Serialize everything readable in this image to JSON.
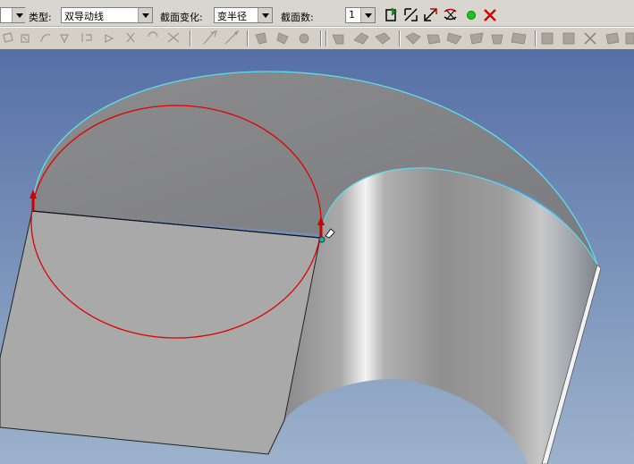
{
  "toolbar": {
    "type_label": "类型:",
    "type_value": "双导动线",
    "section_change_label": "截面变化:",
    "section_change_value": "变半径",
    "section_count_label": "截面数:",
    "section_count_value": "1"
  },
  "colors": {
    "guide_curve": "#e00000",
    "edge_highlight": "#58e0f0",
    "surface": "#9a9a9a",
    "background_top": "#5670a6",
    "background_bottom": "#9cb2cc"
  },
  "icons": {
    "action_buttons": [
      "apply-icon",
      "pick-curve-icon",
      "pick-curve-2-icon",
      "swap-icon",
      "confirm-dot-icon",
      "cancel-x-icon"
    ],
    "greyed_tools": [
      "sketch-icon",
      "rotate-icon",
      "sweep-icon",
      "extrude-icon",
      "cut-icon",
      "mirror-icon",
      "pattern-icon",
      "trim-icon",
      "line-icon",
      "arc-icon",
      "spline-icon",
      "point-icon",
      "fill-icon",
      "paint-icon",
      "fillet-icon",
      "chamfer-icon",
      "shell-icon",
      "draft-icon",
      "rib-icon",
      "hole-icon",
      "thread-icon",
      "boolean-icon",
      "scale-icon",
      "copy-icon",
      "delete-icon",
      "layer-icon"
    ]
  }
}
